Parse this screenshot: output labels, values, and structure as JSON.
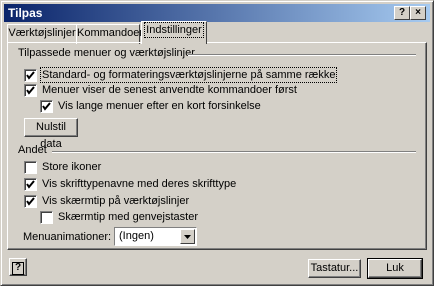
{
  "window": {
    "title": "Tilpas",
    "help_label": "?",
    "close_label": "×"
  },
  "tabs": [
    {
      "label": "Værktøjslinjer"
    },
    {
      "label": "Kommandoer"
    },
    {
      "label": "Indstillinger"
    }
  ],
  "group1": {
    "title": "Tilpassede menuer og værktøjslinjer",
    "options": [
      {
        "label": "Standard- og formateringsværktøjslinjerne på samme række",
        "checked": true
      },
      {
        "label": "Menuer viser de senest anvendte kommandoer først",
        "checked": true
      },
      {
        "label": "Vis lange menuer efter en kort forsinkelse",
        "checked": true
      }
    ],
    "reset_button": "Nulstil data"
  },
  "group2": {
    "title": "Andet",
    "options": [
      {
        "label": "Store ikoner",
        "checked": false
      },
      {
        "label": "Vis skrifttypenavne med deres skrifttype",
        "checked": true
      },
      {
        "label": "Vis skærmtip på værktøjslinjer",
        "checked": true
      },
      {
        "label": "Skærmtip med genvejstaster",
        "checked": false
      }
    ],
    "animation_label": "Menuanimationer:",
    "animation_value": "(Ingen)"
  },
  "footer": {
    "help_icon_label": "?",
    "keyboard_button": "Tastatur...",
    "close_button": "Luk"
  }
}
